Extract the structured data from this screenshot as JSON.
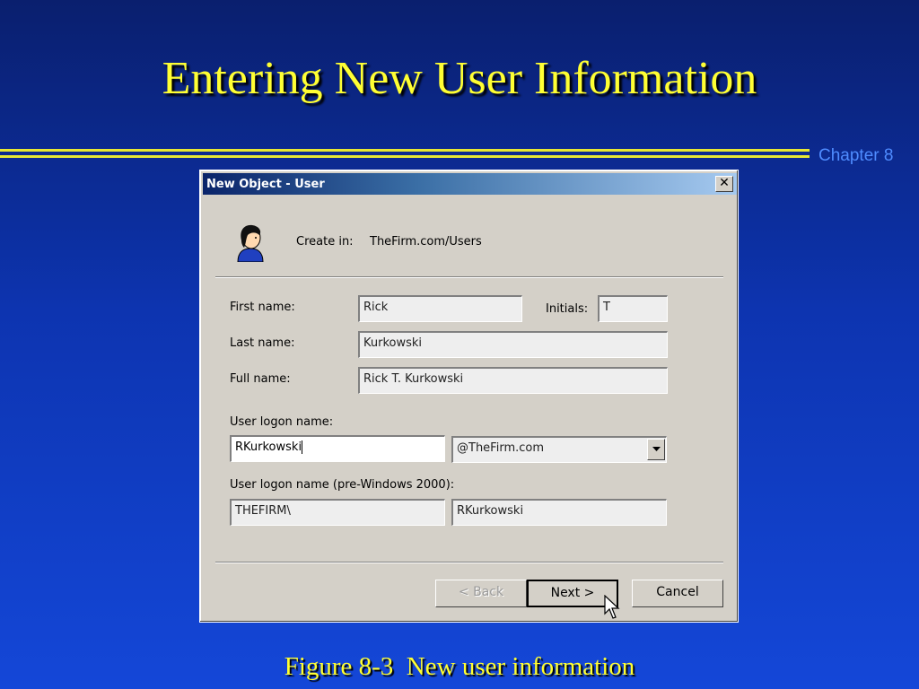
{
  "slide": {
    "title": "Entering New User Information",
    "chapter": "Chapter 8",
    "caption": "Figure 8-3  New user information"
  },
  "dialog": {
    "title": "New Object - User",
    "close_label": "✕",
    "create_in_label": "Create in:",
    "create_in_value": "TheFirm.com/Users",
    "first_name_label": "First name:",
    "first_name_value": "Rick",
    "initials_label": "Initials:",
    "initials_value": "T",
    "last_name_label": "Last name:",
    "last_name_value": "Kurkowski",
    "full_name_label": "Full name:",
    "full_name_value": "Rick T. Kurkowski",
    "logon_label": "User logon name:",
    "logon_value": "RKurkowski",
    "domain_selected": "@TheFirm.com",
    "pre2000_label": "User logon name (pre-Windows 2000):",
    "pre2000_domain": "THEFIRM\\",
    "pre2000_user": "RKurkowski",
    "back_label": "< Back",
    "next_label": "Next >",
    "cancel_label": "Cancel"
  },
  "icons": {
    "user": "user-icon",
    "close": "close-icon",
    "dropdown": "chevron-down-icon",
    "cursor": "mouse-pointer-icon"
  },
  "colors": {
    "title_yellow": "#ffff33",
    "chapter_blue": "#4f8cff",
    "dialog_face": "#d4d0c8",
    "titlebar_start": "#0a246a",
    "titlebar_end": "#a6caf0"
  }
}
